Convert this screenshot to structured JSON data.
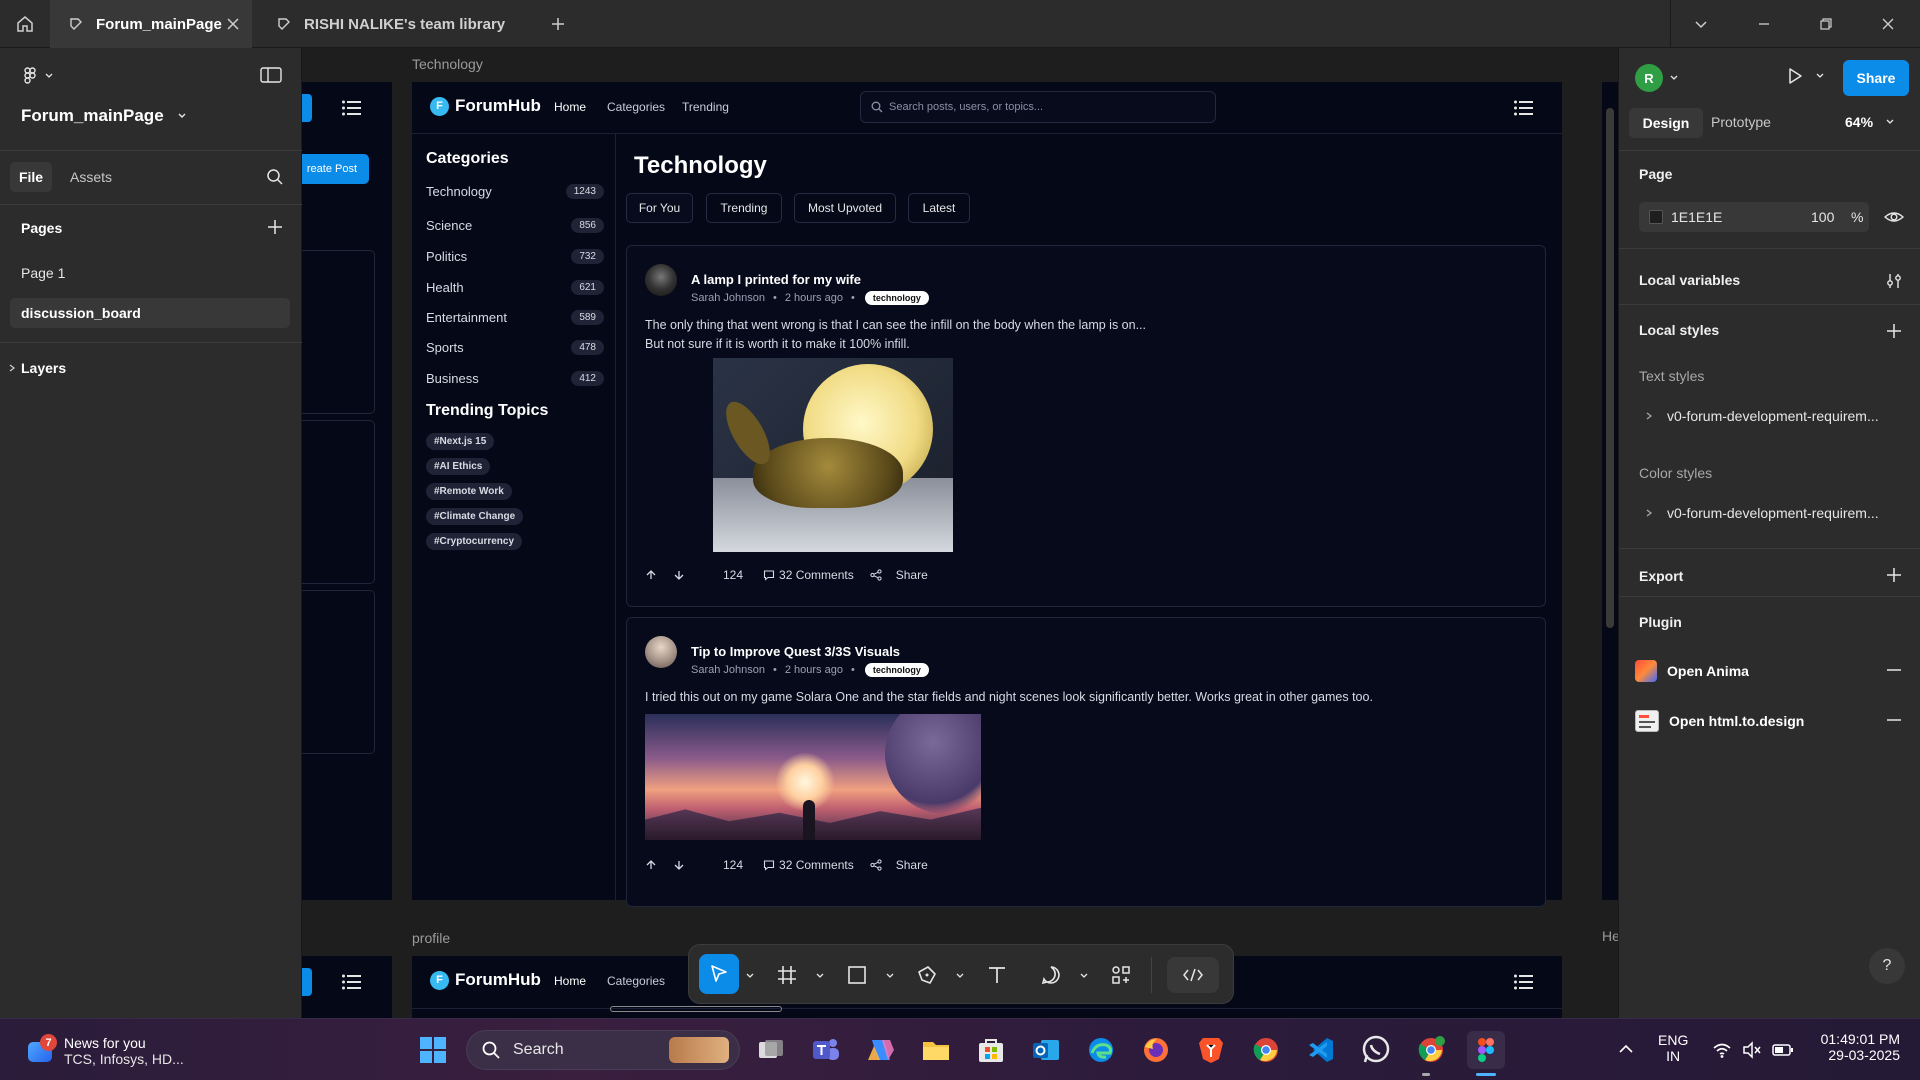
{
  "tabs": [
    {
      "label": "Forum_mainPage"
    },
    {
      "label": "RISHI NALIKE's team library"
    }
  ],
  "left": {
    "file_name": "Forum_mainPage",
    "tab_file": "File",
    "tab_assets": "Assets",
    "pages_heading": "Pages",
    "pages": [
      "Page 1",
      "discussion_board"
    ],
    "layers_heading": "Layers"
  },
  "canvas": {
    "frame1_label": "Technology",
    "frame2_label": "profile",
    "right_frame_label": "He",
    "create_post": "reate Post"
  },
  "forum": {
    "logo_letter": "F",
    "brand": "ForumHub",
    "nav": [
      "Home",
      "Categories",
      "Trending"
    ],
    "search_placeholder": "Search posts, users, or topics...",
    "categories_heading": "Categories",
    "categories": [
      {
        "name": "Technology",
        "count": "1243"
      },
      {
        "name": "Science",
        "count": "856"
      },
      {
        "name": "Politics",
        "count": "732"
      },
      {
        "name": "Health",
        "count": "621"
      },
      {
        "name": "Entertainment",
        "count": "589"
      },
      {
        "name": "Sports",
        "count": "478"
      },
      {
        "name": "Business",
        "count": "412"
      }
    ],
    "trending_heading": "Trending Topics",
    "topics": [
      "#Next.js 15",
      "#AI Ethics",
      "#Remote Work",
      "#Climate Change",
      "#Cryptocurrency"
    ],
    "page_title": "Technology",
    "filters": [
      "For You",
      "Trending",
      "Most Upvoted",
      "Latest"
    ],
    "posts": [
      {
        "title": "A lamp I printed for my wife",
        "author": "Sarah Johnson",
        "time": "2 hours ago",
        "tag": "technology",
        "body1": "The only thing that went wrong is that I can see the infill on the body when the lamp is on...",
        "body2": "But not sure if it is worth it to make it 100% infill.",
        "votes": "124",
        "comments": "32 Comments",
        "share": "Share"
      },
      {
        "title": "Tip to Improve Quest 3/3S Visuals",
        "author": "Sarah Johnson",
        "time": "2 hours ago",
        "tag": "technology",
        "body1": "I tried this out on my game Solara One and the star fields and night scenes look significantly better. Works great in other games too.",
        "votes": "124",
        "comments": "32 Comments",
        "share": "Share"
      }
    ],
    "bottom_nav": [
      "Home",
      "Categories"
    ]
  },
  "right": {
    "avatar_letter": "R",
    "share": "Share",
    "tab_design": "Design",
    "tab_prototype": "Prototype",
    "zoom": "64%",
    "page_heading": "Page",
    "page_color": "1E1E1E",
    "page_opacity": "100",
    "percent": "%",
    "local_variables": "Local variables",
    "local_styles": "Local styles",
    "text_styles": "Text styles",
    "text_style_item": "v0-forum-development-requirem...",
    "color_styles": "Color styles",
    "color_style_item": "v0-forum-development-requirem...",
    "export": "Export",
    "plugin": "Plugin",
    "plugins": [
      "Open Anima",
      "Open html.to.design"
    ],
    "help": "?"
  },
  "taskbar": {
    "news_badge": "7",
    "news_title": "News for you",
    "news_sub": "TCS, Infosys, HD...",
    "search": "Search",
    "lang1": "ENG",
    "lang2": "IN",
    "time": "01:49:01 PM",
    "date": "29-03-2025"
  },
  "colors": {
    "accent": "#0c8ce9",
    "forum_bg": "#050817",
    "panel_bg": "#2c2c2c"
  }
}
